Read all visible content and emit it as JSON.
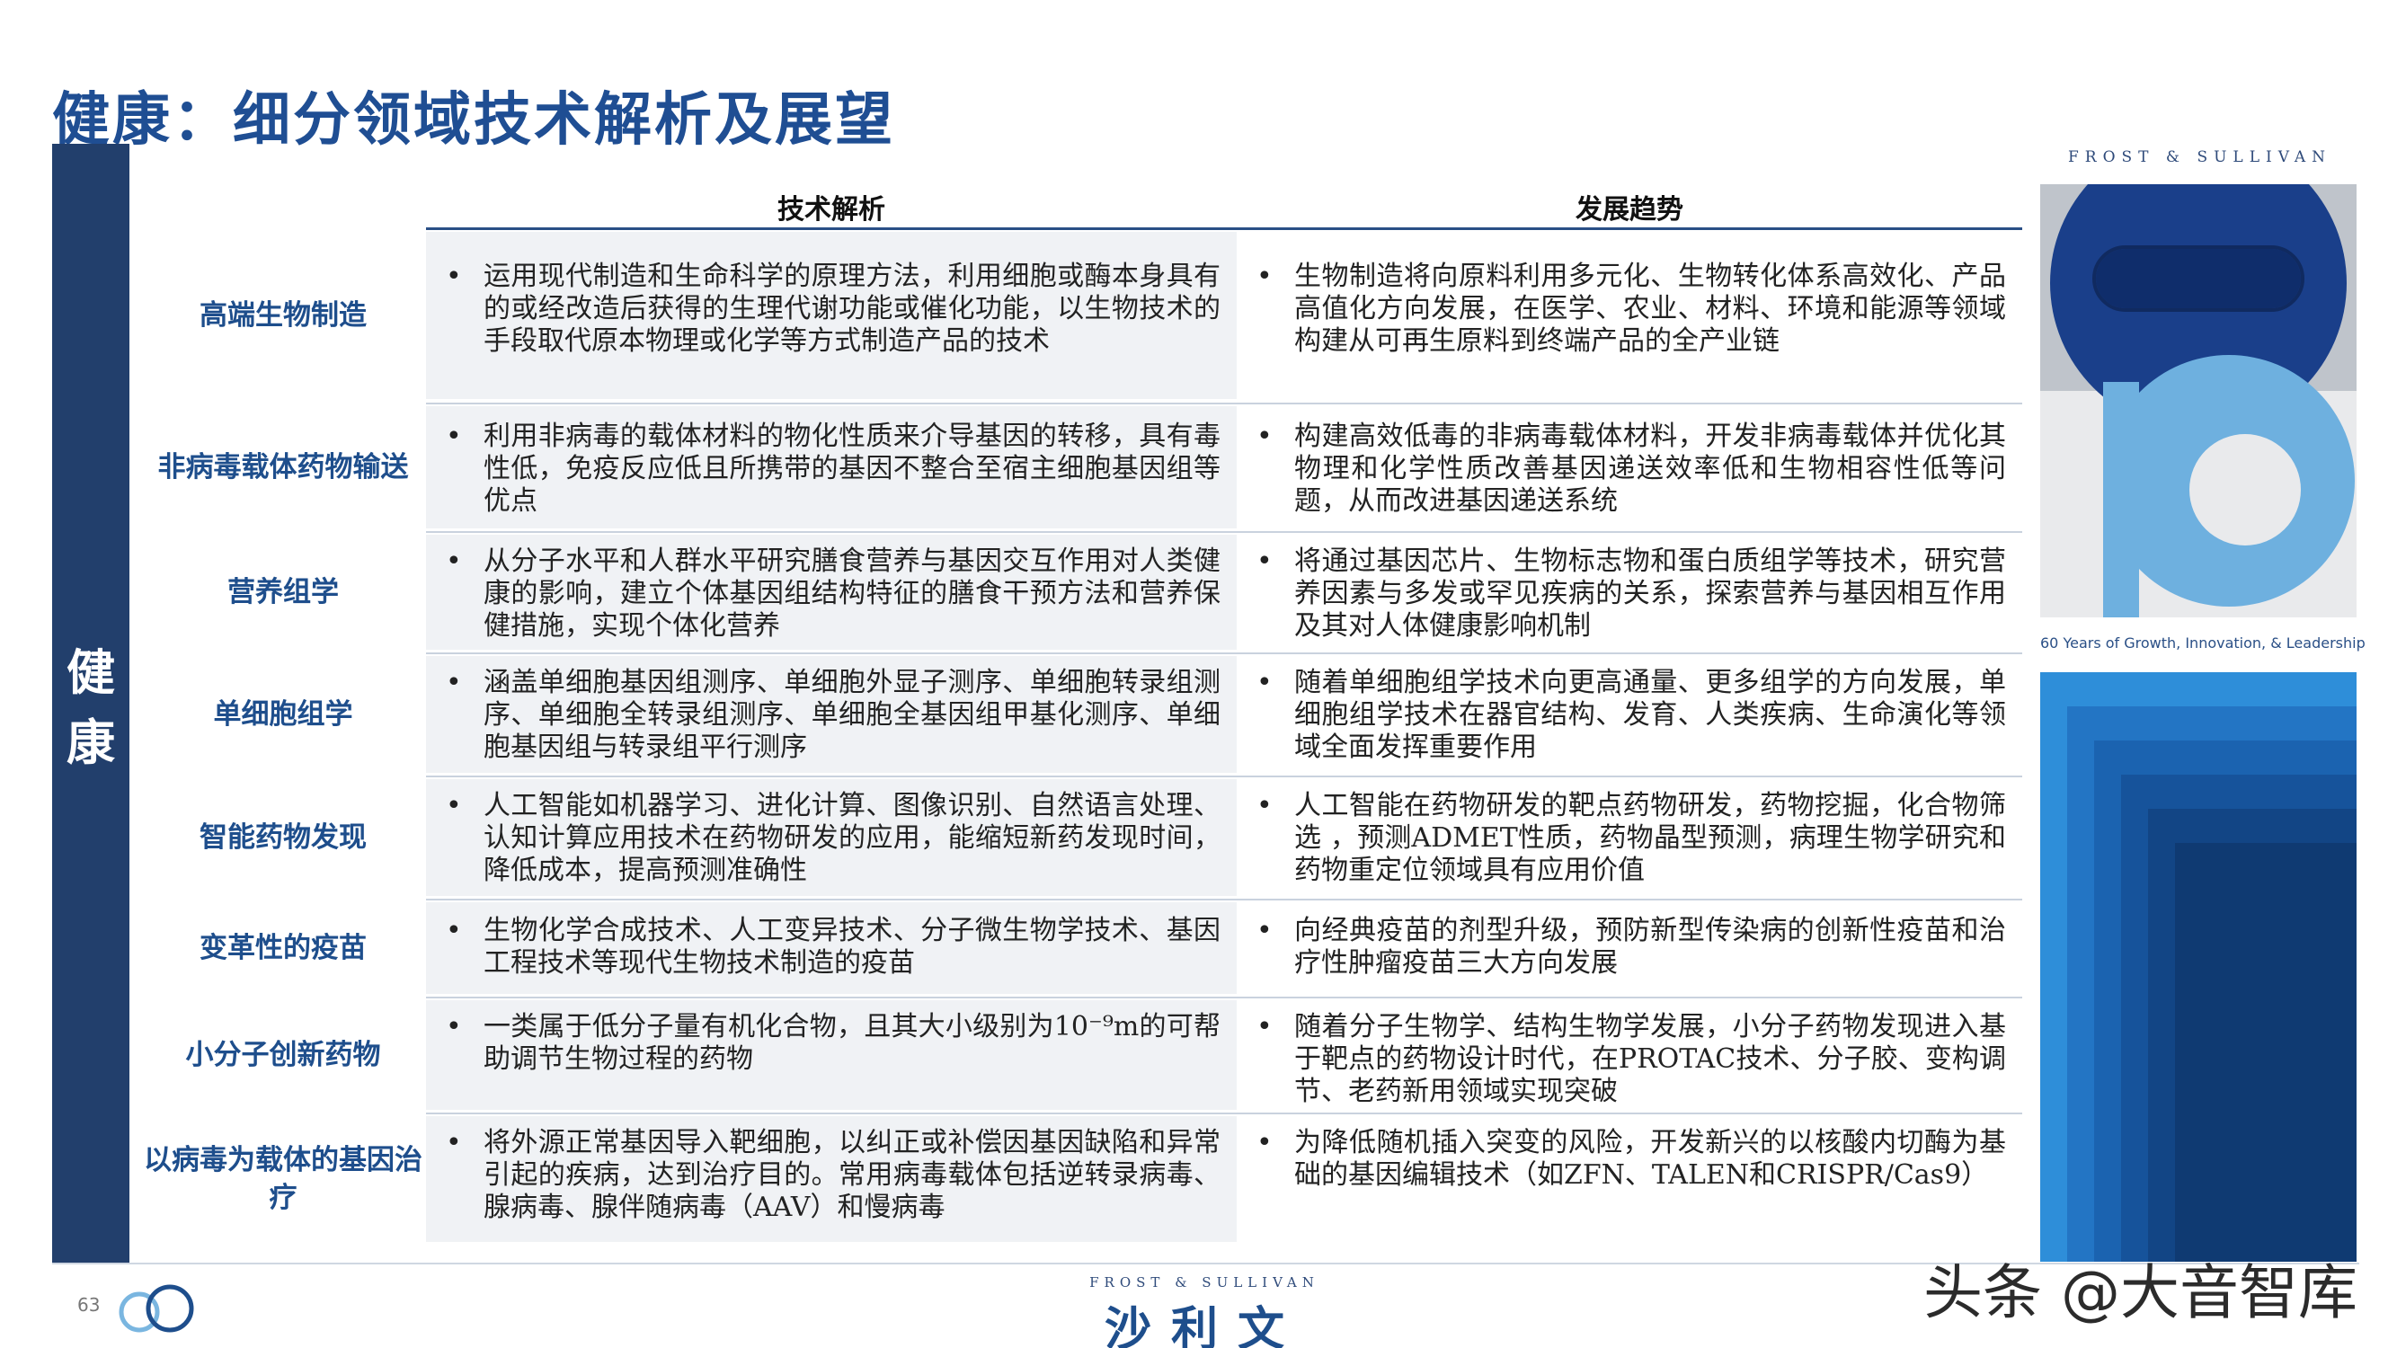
{
  "title": "健康：细分领域技术解析及展望",
  "sidebar_label": "健康",
  "columns": {
    "analysis": "技术解析",
    "trend": "发展趋势"
  },
  "rows": [
    {
      "label": "高端生物制造",
      "analysis": "运用现代制造和生命科学的原理方法，利用细胞或酶本身具有的或经改造后获得的生理代谢功能或催化功能，以生物技术的手段取代原本物理或化学等方式制造产品的技术",
      "trend": "生物制造将向原料利用多元化、生物转化体系高效化、产品高值化方向发展，在医学、农业、材料、环境和能源等领域构建从可再生原料到终端产品的全产业链"
    },
    {
      "label": "非病毒载体药物输送",
      "analysis": "利用非病毒的载体材料的物化性质来介导基因的转移，具有毒性低，免疫反应低且所携带的基因不整合至宿主细胞基因组等优点",
      "trend": "构建高效低毒的非病毒载体材料，开发非病毒载体并优化其物理和化学性质改善基因递送效率低和生物相容性低等问题，从而改进基因递送系统"
    },
    {
      "label": "营养组学",
      "analysis": "从分子水平和人群水平研究膳食营养与基因交互作用对人类健康的影响，建立个体基因组结构特征的膳食干预方法和营养保健措施，实现个体化营养",
      "trend": "将通过基因芯片、生物标志物和蛋白质组学等技术，研究营养因素与多发或罕见疾病的关系，探索营养与基因相互作用及其对人体健康影响机制"
    },
    {
      "label": "单细胞组学",
      "analysis": "涵盖单细胞基因组测序、单细胞外显子测序、单细胞转录组测序、单细胞全转录组测序、单细胞全基因组甲基化测序、单细胞基因组与转录组平行测序",
      "trend": "随着单细胞组学技术向更高通量、更多组学的方向发展，单细胞组学技术在器官结构、发育、人类疾病、生命演化等领域全面发挥重要作用"
    },
    {
      "label": "智能药物发现",
      "analysis": "人工智能如机器学习、进化计算、图像识别、自然语言处理、认知计算应用技术在药物研发的应用，能缩短新药发现时间，降低成本，提高预测准确性",
      "trend": "人工智能在药物研发的靶点药物研发，药物挖掘，化合物筛选 ，预测ADMET性质，药物晶型预测，病理生物学研究和药物重定位领域具有应用价值"
    },
    {
      "label": "变革性的疫苗",
      "analysis": "生物化学合成技术、人工变异技术、分子微生物学技术、基因工程技术等现代生物技术制造的疫苗",
      "trend": "向经典疫苗的剂型升级，预防新型传染病的创新性疫苗和治疗性肿瘤疫苗三大方向发展"
    },
    {
      "label": "小分子创新药物",
      "analysis": "一类属于低分子量有机化合物，且其大小级别为10⁻⁹m的可帮助调节生物过程的药物",
      "trend": "随着分子生物学、结构生物学发展，小分子药物发现进入基于靶点的药物设计时代，在PROTAC技术、分子胶、变构调节、老药新用领域实现突破"
    },
    {
      "label": "以病毒为载体的基因治疗",
      "analysis": "将外源正常基因导入靶细胞，以纠正或补偿因基因缺陷和异常引起的疾病，达到治疗目的。常用病毒载体包括逆转录病毒、腺病毒、腺伴随病毒（AAV）和慢病毒",
      "trend": "为降低随机插入突变的风险，开发新兴的以核酸内切酶为基础的基因编辑技术（如ZFN、TALEN和CRISPR/Cas9）"
    }
  ],
  "branding": {
    "frost_sullivan": "FROST & SULLIVAN",
    "tagline": "60 Years of Growth, Innovation, & Leadership",
    "footer_cn": "沙利文",
    "page_number": "63",
    "watermark": "头条 @大音智库"
  },
  "colors": {
    "primary": "#1f4e93",
    "sidebar": "#223f6c",
    "art_dark": "#1a3f8a",
    "art_light": "#6eb0df"
  }
}
